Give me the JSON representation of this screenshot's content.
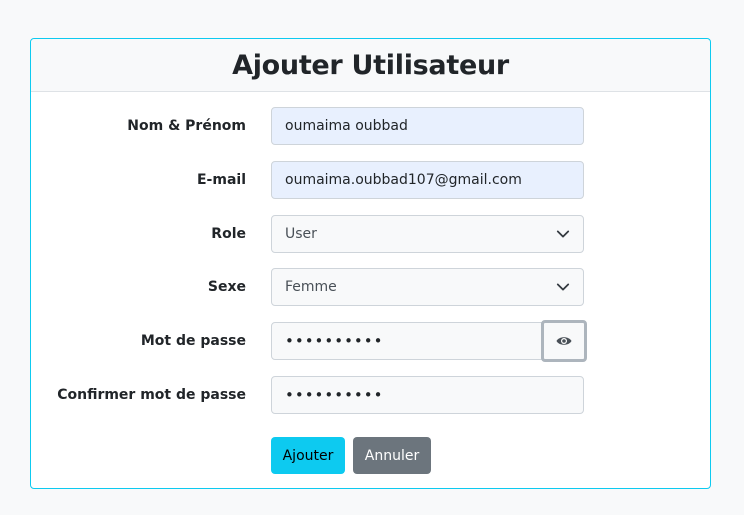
{
  "form": {
    "title": "Ajouter Utilisateur",
    "fields": {
      "name": {
        "label": "Nom & Prénom",
        "value": "oumaima oubbad"
      },
      "email": {
        "label": "E-mail",
        "value": "oumaima.oubbad107@gmail.com"
      },
      "role": {
        "label": "Role",
        "value": "User"
      },
      "sexe": {
        "label": "Sexe",
        "value": "Femme"
      },
      "password": {
        "label": "Mot de passe",
        "value": "••••••••••"
      },
      "confirm": {
        "label": "Confirmer mot de passe",
        "value": "••••••••••"
      }
    },
    "buttons": {
      "add": "Ajouter",
      "cancel": "Annuler"
    }
  },
  "colors": {
    "accent": "#0dcaf0",
    "secondary": "#6c757d",
    "autofill": "#e8f0fe"
  },
  "icons": {
    "select": "chevron-down-icon",
    "toggle_password": "eye-icon"
  }
}
